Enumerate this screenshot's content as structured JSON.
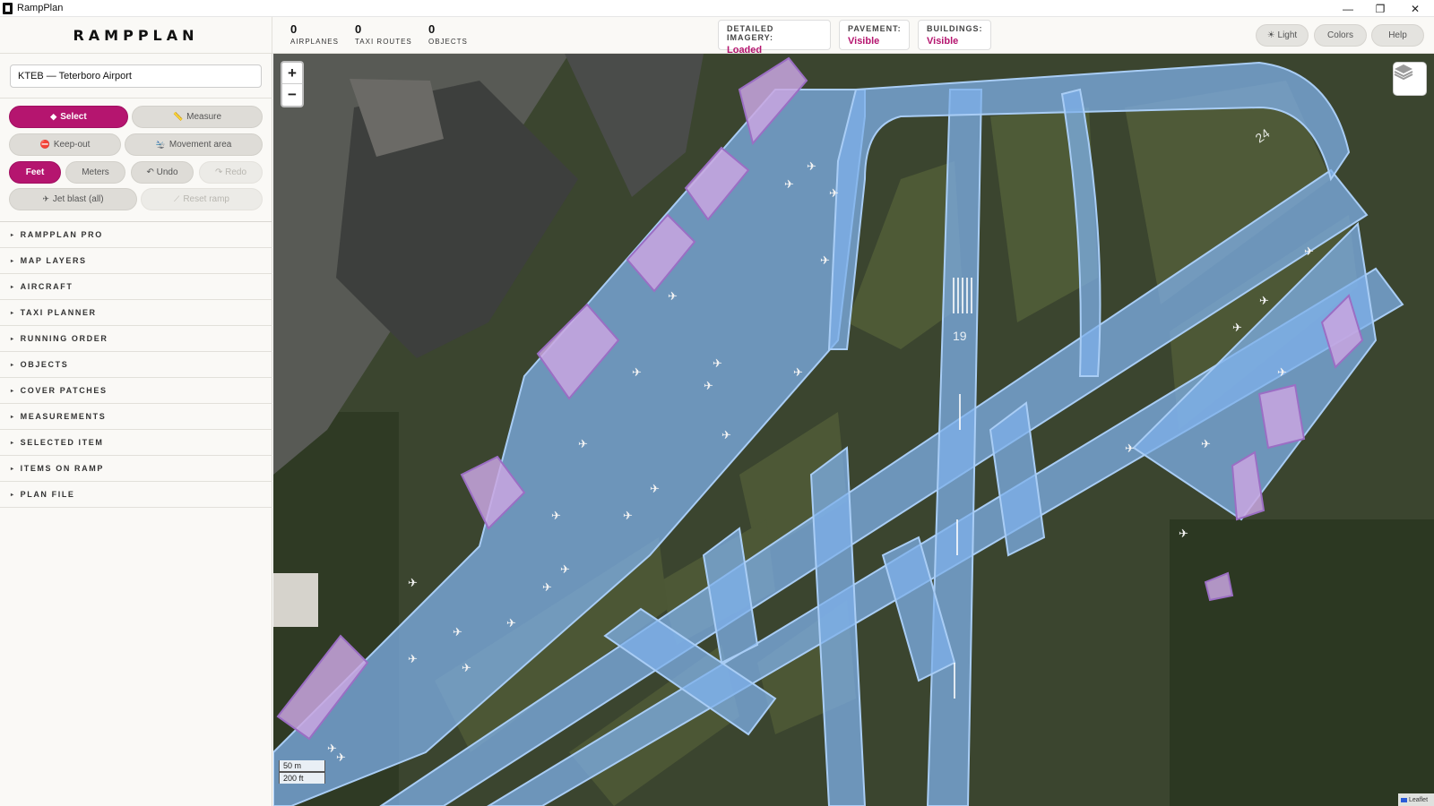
{
  "window": {
    "title": "RampPlan",
    "min": "—",
    "max": "❐",
    "close": "✕"
  },
  "header": {
    "brand": "RAMPPLAN",
    "stats": [
      {
        "value": "0",
        "label": "AIRPLANES"
      },
      {
        "value": "0",
        "label": "TAXI ROUTES"
      },
      {
        "value": "0",
        "label": "OBJECTS"
      }
    ],
    "status": [
      {
        "label": "DETAILED IMAGERY:",
        "value": "Loaded"
      },
      {
        "label": "PAVEMENT:",
        "value": "Visible"
      },
      {
        "label": "BUILDINGS:",
        "value": "Visible"
      }
    ],
    "buttons": {
      "light": "☀ Light",
      "colors": "Colors",
      "help": "Help"
    }
  },
  "sidebar": {
    "search_value": "KTEB — Teterboro Airport",
    "tools": {
      "select": "Select",
      "measure": "Measure",
      "keepout": "Keep-out",
      "movement": "Movement area",
      "feet": "Feet",
      "meters": "Meters",
      "undo": "↶ Undo",
      "redo": "↷ Redo",
      "jetblast": "Jet blast (all)",
      "reset": "Reset ramp"
    },
    "sections": [
      "RAMPPLAN PRO",
      "MAP LAYERS",
      "AIRCRAFT",
      "TAXI PLANNER",
      "RUNNING ORDER",
      "OBJECTS",
      "COVER PATCHES",
      "MEASUREMENTS",
      "SELECTED ITEM",
      "ITEMS ON RAMP",
      "PLAN FILE"
    ]
  },
  "map": {
    "zoom_in": "+",
    "zoom_out": "−",
    "scale_m": "50 m",
    "scale_ft": "200 ft",
    "attribution": "Leaflet",
    "runway_number": "19",
    "runway_number_2": "24",
    "colors": {
      "pavement": "#7fb0ea",
      "building": "#c9a6e0",
      "accent": "#b5156f"
    }
  }
}
